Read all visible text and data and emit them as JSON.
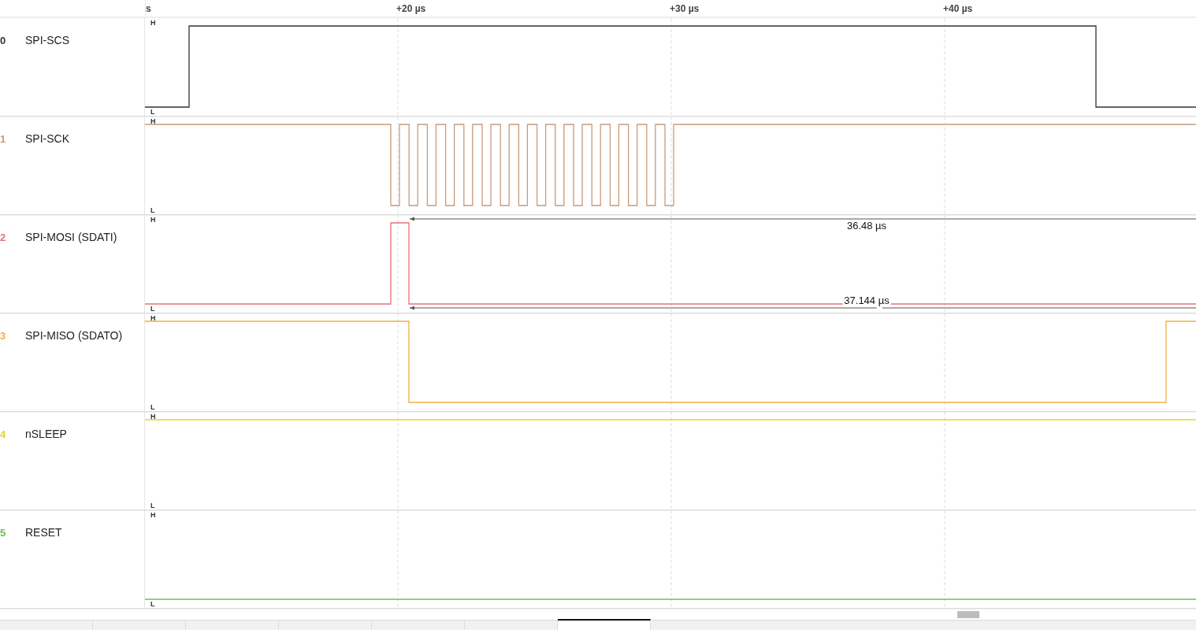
{
  "ruler": {
    "labels": [
      "s",
      "+20 µs",
      "+30 µs",
      "+40 µs"
    ]
  },
  "channels": [
    {
      "number": "0",
      "name": "SPI-SCS",
      "color": "#333333",
      "kind": "pulse",
      "high_label": "H",
      "low_label": "L"
    },
    {
      "number": "1",
      "name": "SPI-SCK",
      "color": "#c89a7a",
      "kind": "clock-burst",
      "high_label": "H",
      "low_label": "L"
    },
    {
      "number": "2",
      "name": "SPI-MOSI (SDATI)",
      "color": "#e8707a",
      "kind": "short-pulse",
      "high_label": "H",
      "low_label": "L",
      "measurements": [
        {
          "kind": "upper",
          "text": "36.48 µs"
        },
        {
          "kind": "lower",
          "text": "37.144 µs"
        }
      ]
    },
    {
      "number": "3",
      "name": "SPI-MISO (SDATO)",
      "color": "#f0b040",
      "kind": "dip",
      "high_label": "H",
      "low_label": "L"
    },
    {
      "number": "4",
      "name": "nSLEEP",
      "color": "#e0d820",
      "kind": "high",
      "high_label": "H",
      "low_label": "L"
    },
    {
      "number": "5",
      "name": "RESET",
      "color": "#6cbf4a",
      "kind": "low",
      "high_label": "H",
      "low_label": "L"
    }
  ],
  "bottom_tabs": [
    {
      "selected": false
    },
    {
      "selected": false
    },
    {
      "selected": false
    },
    {
      "selected": false
    },
    {
      "selected": false
    },
    {
      "selected": false
    },
    {
      "selected": true
    }
  ]
}
